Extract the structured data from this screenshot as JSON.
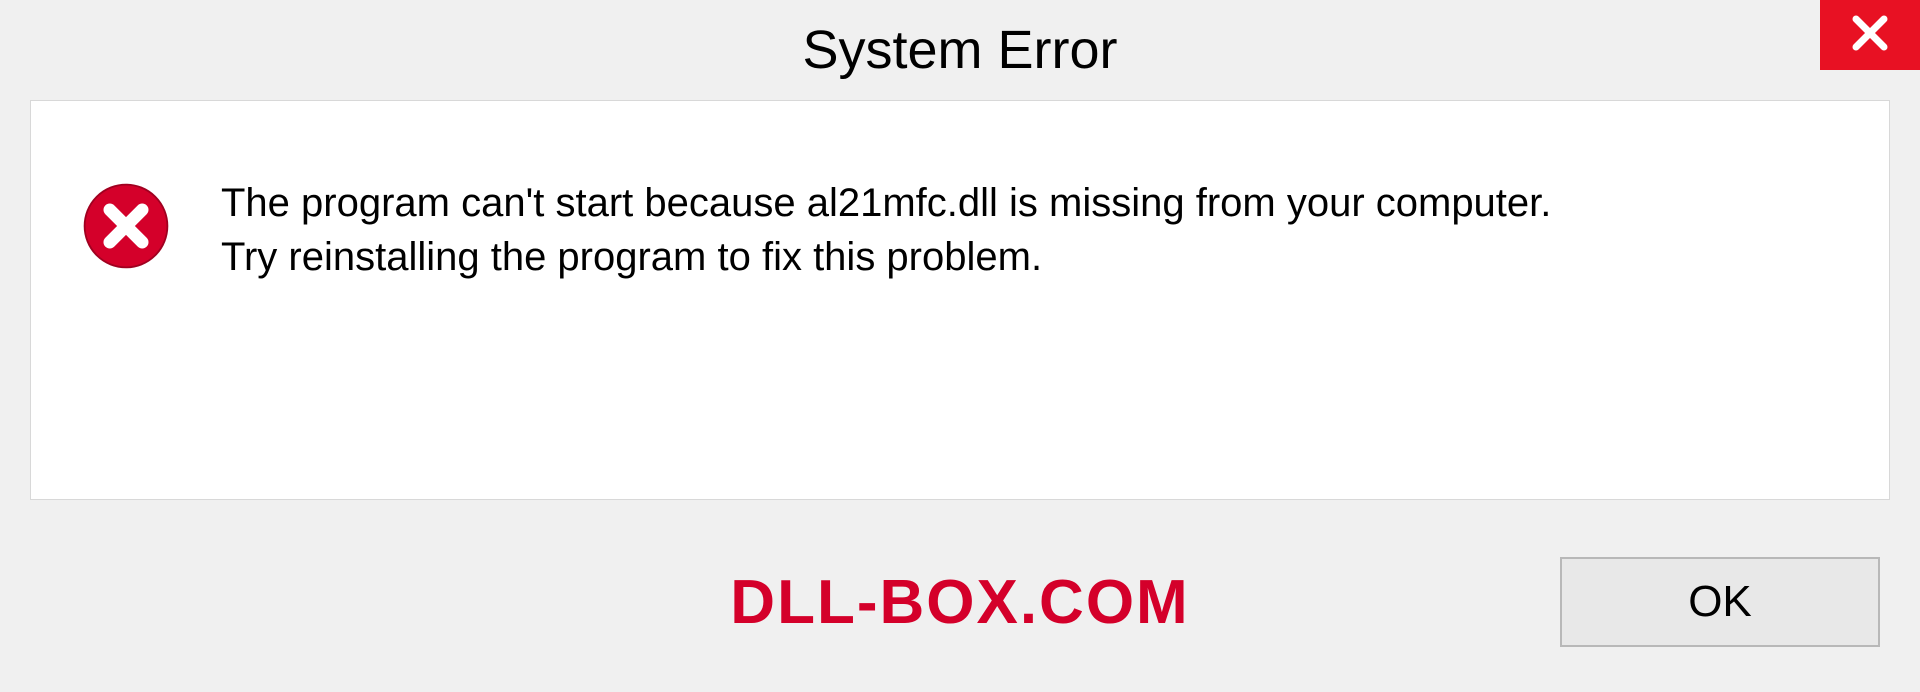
{
  "dialog": {
    "title": "System Error",
    "message_line1": "The program can't start because al21mfc.dll is missing from your computer.",
    "message_line2": "Try reinstalling the program to fix this problem.",
    "ok_label": "OK"
  },
  "watermark": "DLL-BOX.COM"
}
